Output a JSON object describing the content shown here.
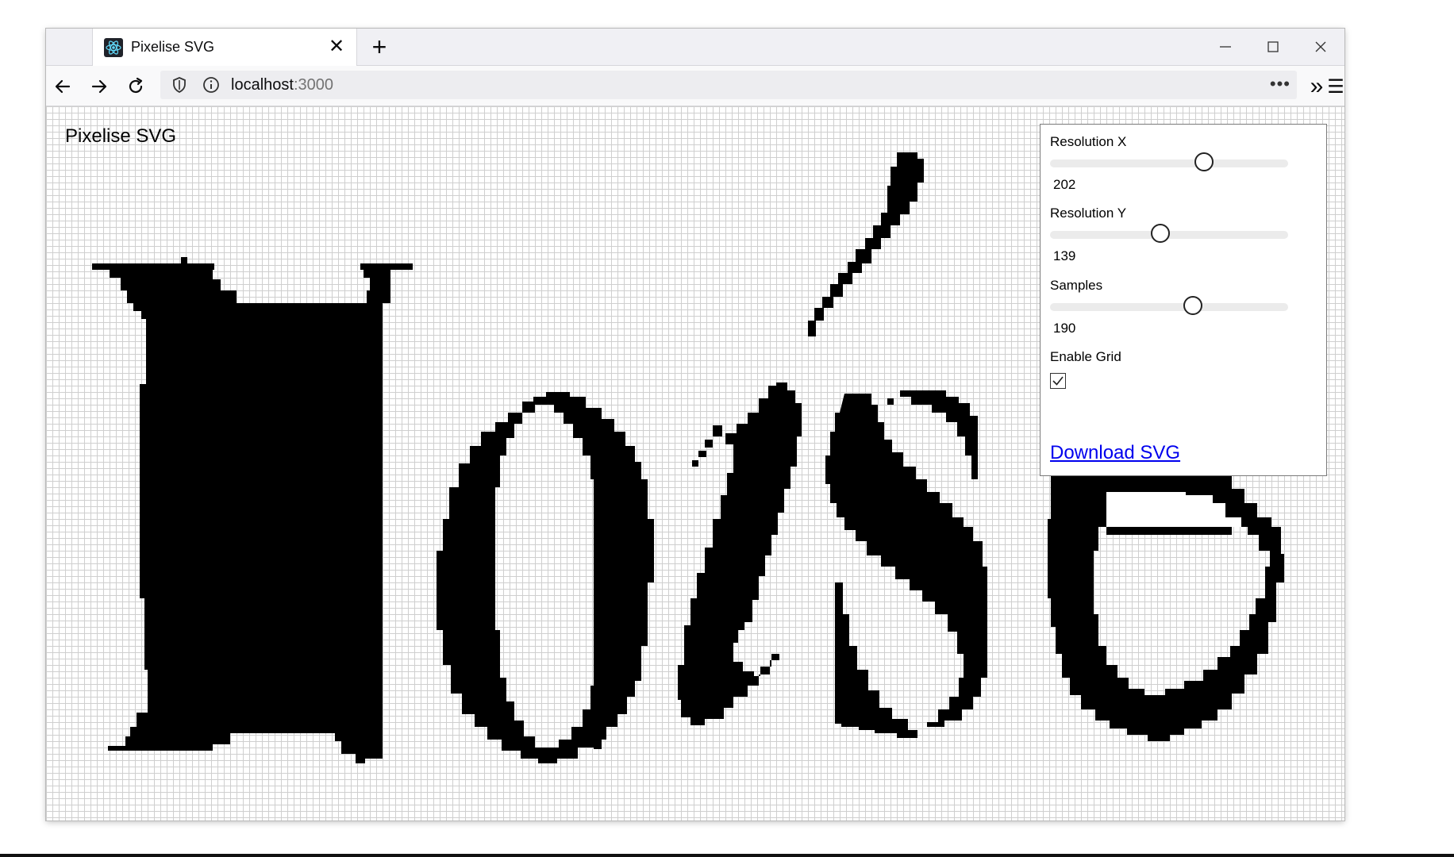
{
  "browser": {
    "tab_title": "Pixelise SVG",
    "url_host": "localhost",
    "url_port": ":3000",
    "new_tab_glyph": "+",
    "close_glyph": "✕",
    "favicon": "react-icon",
    "overflow_glyph": "•••",
    "extensions_glyph": "»",
    "menu_glyph": "☰"
  },
  "page": {
    "title": "Pixelise SVG"
  },
  "controls": {
    "resolution_x": {
      "label": "Resolution X",
      "value": "202",
      "fraction": 0.66
    },
    "resolution_y": {
      "label": "Resolution Y",
      "value": "139",
      "fraction": 0.46
    },
    "samples": {
      "label": "Samples",
      "value": "190",
      "fraction": 0.61
    },
    "enable_grid": {
      "label": "Enable Grid",
      "checked": true
    },
    "download_label": "Download SVG"
  },
  "colors": {
    "pixel_fill": "#000000",
    "grid_line": "#cfcfcf",
    "link": "#0000ee"
  }
}
